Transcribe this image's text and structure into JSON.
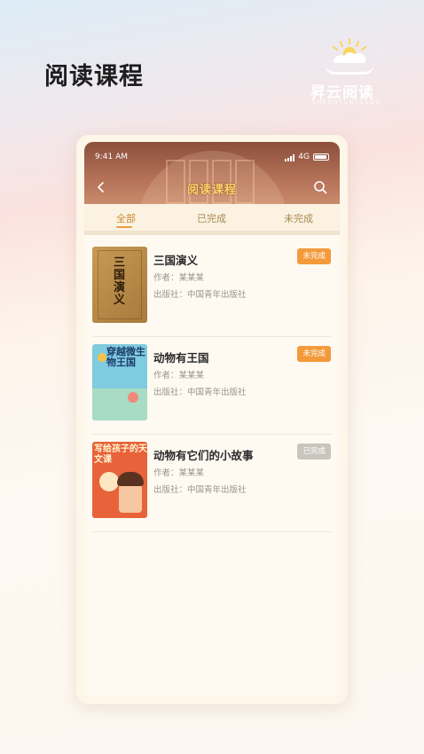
{
  "page": {
    "headline": "阅读课程"
  },
  "logo": {
    "name": "昇云阅读",
    "subtitle": "SHENGYUNYUEDU"
  },
  "status_bar": {
    "time": "9:41 AM",
    "network": "4G"
  },
  "nav": {
    "title": "阅读课程"
  },
  "tabs": [
    {
      "label": "全部",
      "active": true
    },
    {
      "label": "已完成",
      "active": false
    },
    {
      "label": "未完成",
      "active": false
    }
  ],
  "books": [
    {
      "title": "三国演义",
      "author": "作者：某某某",
      "publisher": "出版社：中国青年出版社",
      "status": "未完成",
      "status_color": "#f39a3a",
      "cover_text": "三国演义"
    },
    {
      "title": "动物有王国",
      "author": "作者：某某某",
      "publisher": "出版社：中国青年出版社",
      "status": "未完成",
      "status_color": "#f39a3a",
      "cover_text": "穿越微生物王国"
    },
    {
      "title": "动物有它们的小故事",
      "author": "作者：某某某",
      "publisher": "出版社：中国青年出版社",
      "status": "已完成",
      "status_color": "#c9c5bd",
      "cover_text": "写给孩子的天文课"
    }
  ]
}
